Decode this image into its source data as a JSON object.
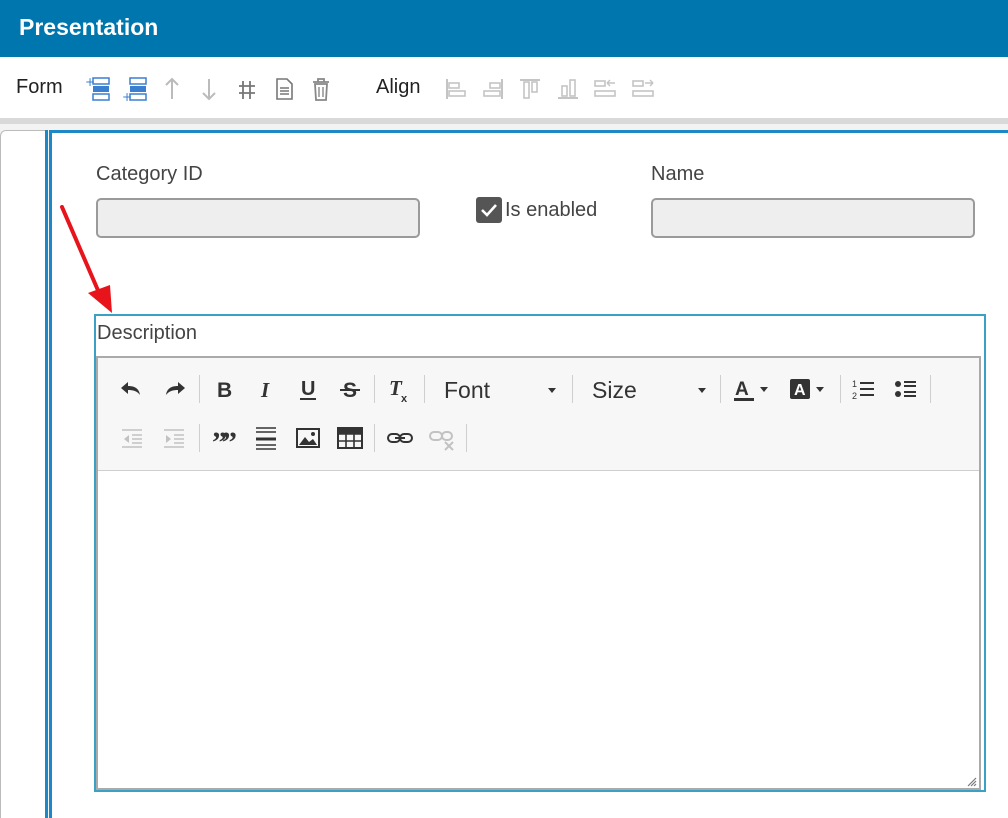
{
  "header": {
    "title": "Presentation"
  },
  "toolbar": {
    "form_label": "Form",
    "form_icons": [
      "insert-row-before-icon",
      "insert-row-after-icon",
      "move-up-icon",
      "move-down-icon",
      "grid-icon",
      "document-icon",
      "delete-icon"
    ],
    "align_label": "Align",
    "align_icons": [
      "align-left-icon",
      "align-right-icon",
      "align-top-icon",
      "align-bottom-icon",
      "distribute-left-icon",
      "distribute-right-icon"
    ]
  },
  "form": {
    "category_id": {
      "label": "Category ID",
      "value": ""
    },
    "is_enabled": {
      "label": "Is enabled",
      "checked": true
    },
    "name": {
      "label": "Name",
      "value": ""
    },
    "description": {
      "label": "Description",
      "value": ""
    }
  },
  "editor": {
    "font_label": "Font",
    "size_label": "Size",
    "buttons": [
      "undo-icon",
      "redo-icon",
      "bold-icon",
      "italic-icon",
      "underline-icon",
      "strikethrough-icon",
      "remove-format-icon",
      "text-color-icon",
      "background-color-icon",
      "numbered-list-icon",
      "bulleted-list-icon",
      "decrease-indent-icon",
      "increase-indent-icon",
      "blockquote-icon",
      "horizontal-rule-icon",
      "image-icon",
      "table-icon",
      "link-icon",
      "unlink-icon"
    ]
  },
  "colors": {
    "header_bg": "#0076ae",
    "accent_border": "#1e88c7",
    "focus_border": "#3aa0c4",
    "annotation_arrow": "#e8141c"
  }
}
